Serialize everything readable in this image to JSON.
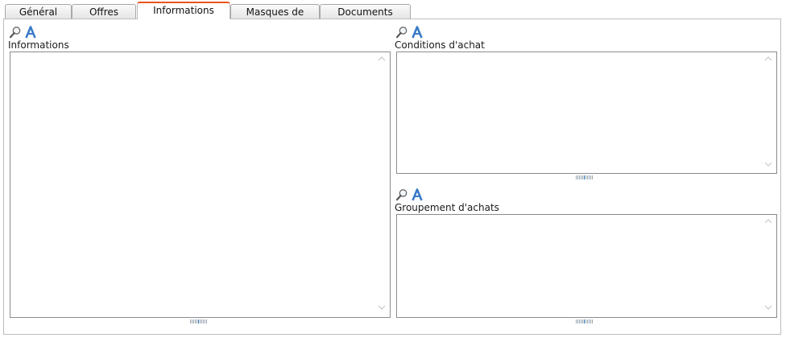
{
  "tabs": [
    {
      "label": "Général",
      "active": false
    },
    {
      "label": "Offres",
      "active": false
    },
    {
      "label": "Informations",
      "active": true
    },
    {
      "label": "Masques de saisie",
      "active": false
    },
    {
      "label": "Documents",
      "active": false
    }
  ],
  "fields": {
    "informations": {
      "label": "Informations",
      "value": ""
    },
    "conditions_achat": {
      "label": "Conditions d'achat",
      "value": ""
    },
    "groupement_achats": {
      "label": "Groupement d'achats",
      "value": ""
    }
  },
  "colors": {
    "active_tab_accent": "#e8541e",
    "font_icon": "#3a7bc8"
  },
  "icons": {
    "search": "magnifier-icon",
    "font": "font-icon"
  }
}
